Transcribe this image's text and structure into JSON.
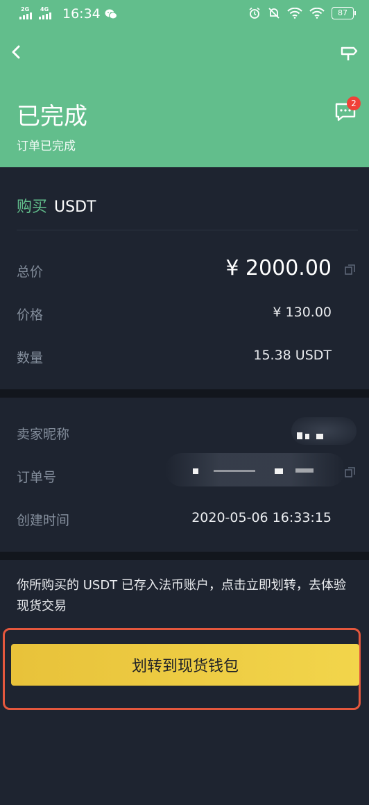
{
  "status_bar": {
    "signal_1": "2G",
    "signal_2": "4G",
    "time": "16:34",
    "battery": "87"
  },
  "header": {
    "title": "已完成",
    "subtitle": "订单已完成",
    "chat_badge": "2"
  },
  "order": {
    "side": "购买",
    "asset": "USDT",
    "rows": [
      {
        "label": "总价",
        "value": "¥ 2000.00"
      },
      {
        "label": "价格",
        "value": "¥ 130.00"
      },
      {
        "label": "数量",
        "value": "15.38 USDT"
      }
    ]
  },
  "details": {
    "rows": [
      {
        "label": "卖家昵称",
        "value": ""
      },
      {
        "label": "订单号",
        "value": ""
      },
      {
        "label": "创建时间",
        "value": "2020-05-06 16:33:15"
      }
    ]
  },
  "notice": {
    "text": "你所购买的 USDT 已存入法币账户，点击立即划转，去体验现货交易",
    "button_label": "划转到现货钱包"
  },
  "colors": {
    "header_bg": "#62be8c",
    "page_bg": "#1e2430",
    "accent_green": "#62be8c",
    "button_yellow": "#f0cf45",
    "highlight_red": "#e4573d",
    "badge_red": "#f04138"
  }
}
